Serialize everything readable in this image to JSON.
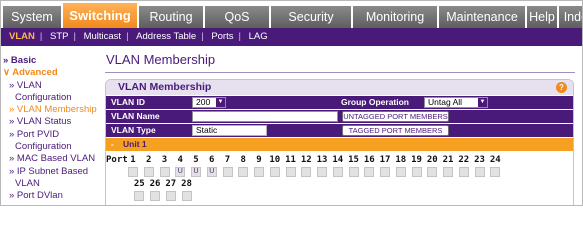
{
  "tabs": [
    {
      "label": "System",
      "active": false
    },
    {
      "label": "Switching",
      "active": true
    },
    {
      "label": "Routing",
      "active": false
    },
    {
      "label": "QoS",
      "active": false
    },
    {
      "label": "Security",
      "active": false
    },
    {
      "label": "Monitoring",
      "active": false
    },
    {
      "label": "Maintenance",
      "active": false
    },
    {
      "label": "Help",
      "active": false
    },
    {
      "label": "Index",
      "active": false
    }
  ],
  "subnav": {
    "items": [
      "VLAN",
      "STP",
      "Multicast",
      "Address Table",
      "Ports",
      "LAG"
    ],
    "selected": "VLAN"
  },
  "sidebar": {
    "items": [
      {
        "label": "» Basic",
        "kind": "group"
      },
      {
        "label": "∨ Advanced",
        "kind": "group-open"
      },
      {
        "label": "» VLAN",
        "kind": "sub"
      },
      {
        "label": "Configuration",
        "kind": "sub2"
      },
      {
        "label": "» VLAN Membership",
        "kind": "current"
      },
      {
        "label": "» VLAN Status",
        "kind": "sub"
      },
      {
        "label": "» Port PVID",
        "kind": "sub"
      },
      {
        "label": "Configuration",
        "kind": "sub2"
      },
      {
        "label": "» MAC Based VLAN",
        "kind": "sub"
      },
      {
        "label": "» IP Subnet Based",
        "kind": "sub"
      },
      {
        "label": "VLAN",
        "kind": "sub2"
      },
      {
        "label": "» Port DVlan",
        "kind": "sub"
      }
    ]
  },
  "page": {
    "title": "VLAN Membership"
  },
  "panel": {
    "title": "VLAN Membership",
    "help_icon": "?",
    "vlan_id_label": "VLAN ID",
    "vlan_id_value": "200",
    "group_operation_label": "Group Operation",
    "group_operation_value": "Untag All",
    "vlan_name_label": "VLAN Name",
    "vlan_name_value": "",
    "untagged_button": "UNTAGGED PORT MEMBERS",
    "vlan_type_label": "VLAN Type",
    "vlan_type_value": "Static",
    "tagged_button": "TAGGED PORT MEMBERS",
    "unit_toggle": "-",
    "unit_label": "Unit 1",
    "port_label": "Port",
    "ports_row1": [
      "1",
      "2",
      "3",
      "4",
      "5",
      "6",
      "7",
      "8",
      "9",
      "10",
      "11",
      "12",
      "13",
      "14",
      "15",
      "16",
      "17",
      "18",
      "19",
      "20",
      "21",
      "22",
      "23",
      "24"
    ],
    "ports_row1_marks": [
      "",
      "",
      "",
      "U",
      "U",
      "U",
      "",
      "",
      "",
      "",
      "",
      "",
      "",
      "",
      "",
      "",
      "",
      "",
      "",
      "",
      "",
      "",
      "",
      ""
    ],
    "ports_row2": [
      "25",
      "26",
      "27",
      "28"
    ],
    "ports_row2_marks": [
      "",
      "",
      "",
      ""
    ]
  },
  "colors": {
    "accent_orange": "#f08a1a",
    "brand_purple": "#4a1a7a",
    "tab_gray": "#707070"
  }
}
